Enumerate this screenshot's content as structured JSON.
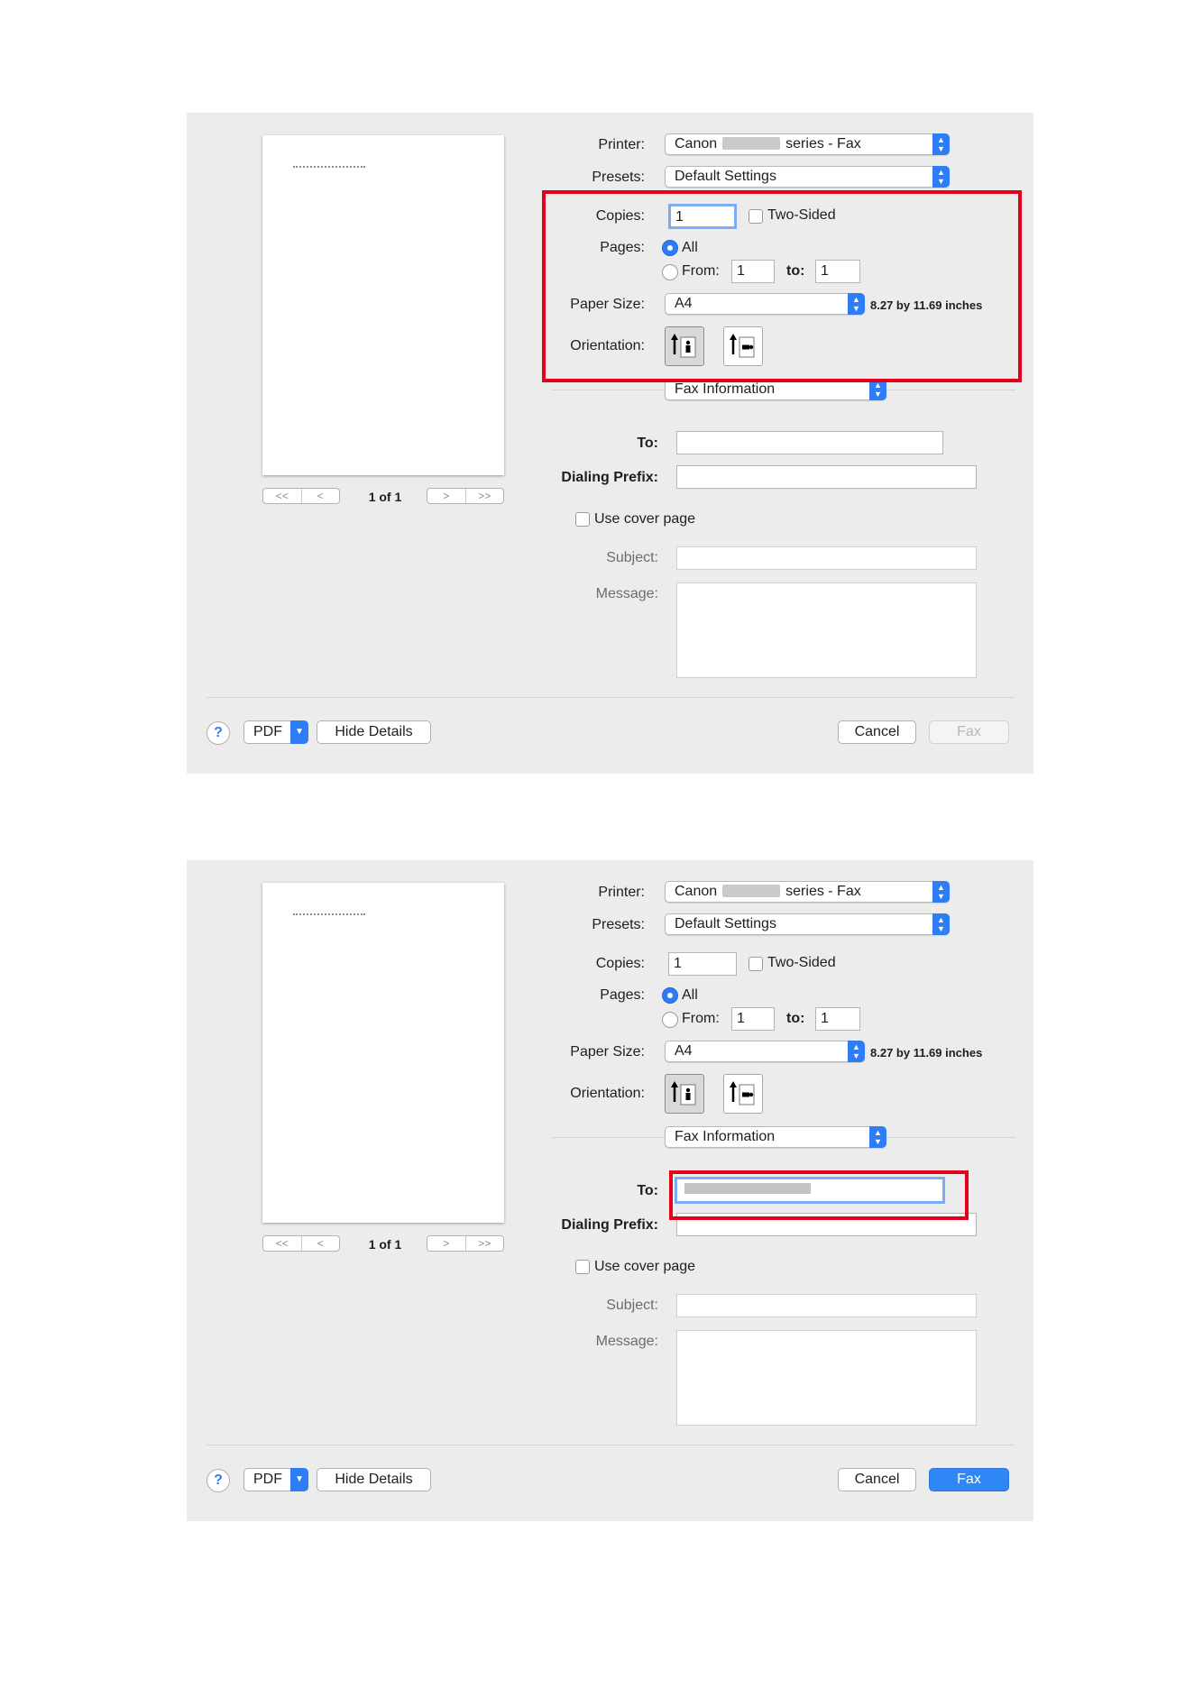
{
  "dialogs": [
    {
      "preview": {
        "page_count": "1 of 1",
        "first_pager": [
          "<<",
          "<"
        ],
        "last_pager": [
          ">",
          ">>"
        ]
      },
      "printer": {
        "label": "Printer:",
        "prefix": "Canon",
        "suffix": "series - Fax"
      },
      "presets": {
        "label": "Presets:",
        "value": "Default Settings"
      },
      "copies": {
        "label": "Copies:",
        "value": "1",
        "two_sided": "Two-Sided"
      },
      "pages": {
        "label": "Pages:",
        "all": "All",
        "from_label": "From:",
        "from": "1",
        "to_label": "to:",
        "to": "1"
      },
      "paper": {
        "label": "Paper Size:",
        "value": "A4",
        "dimensions": "8.27 by 11.69 inches"
      },
      "orientation": {
        "label": "Orientation:"
      },
      "section": {
        "value": "Fax Information"
      },
      "fax": {
        "to_label": "To:",
        "to_value": "",
        "prefix_label": "Dialing Prefix:",
        "cover_label": "Use cover page",
        "subject_label": "Subject:",
        "message_label": "Message:"
      },
      "footer": {
        "help": "?",
        "pdf": "PDF",
        "hide_details": "Hide Details",
        "cancel": "Cancel",
        "fax": "Fax"
      }
    },
    {
      "preview": {
        "page_count": "1 of 1",
        "first_pager": [
          "<<",
          "<"
        ],
        "last_pager": [
          ">",
          ">>"
        ]
      },
      "printer": {
        "label": "Printer:",
        "prefix": "Canon",
        "suffix": "series - Fax"
      },
      "presets": {
        "label": "Presets:",
        "value": "Default Settings"
      },
      "copies": {
        "label": "Copies:",
        "value": "1",
        "two_sided": "Two-Sided"
      },
      "pages": {
        "label": "Pages:",
        "all": "All",
        "from_label": "From:",
        "from": "1",
        "to_label": "to:",
        "to": "1"
      },
      "paper": {
        "label": "Paper Size:",
        "value": "A4",
        "dimensions": "8.27 by 11.69 inches"
      },
      "orientation": {
        "label": "Orientation:"
      },
      "section": {
        "value": "Fax Information"
      },
      "fax": {
        "to_label": "To:",
        "to_value": "",
        "prefix_label": "Dialing Prefix:",
        "cover_label": "Use cover page",
        "subject_label": "Subject:",
        "message_label": "Message:"
      },
      "footer": {
        "help": "?",
        "pdf": "PDF",
        "hide_details": "Hide Details",
        "cancel": "Cancel",
        "fax": "Fax"
      }
    }
  ],
  "colors": {
    "highlight": "#e3001b",
    "accent": "#2f7df5",
    "dialog_bg": "#ececec"
  },
  "icons": [
    "chevron-updown-icon",
    "chevron-down-icon",
    "portrait-orientation-icon",
    "landscape-orientation-icon",
    "help-icon"
  ]
}
